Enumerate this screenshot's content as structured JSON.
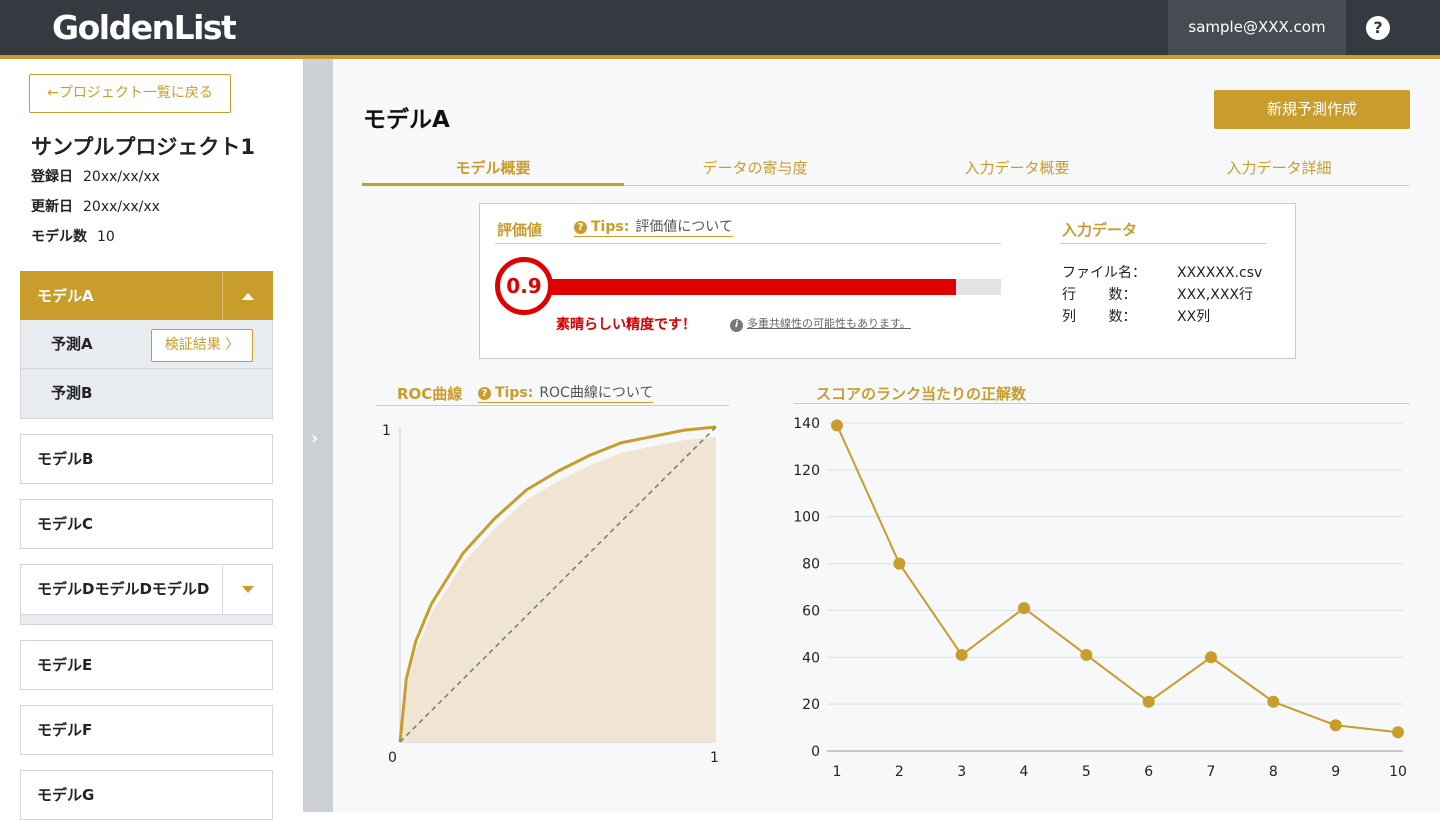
{
  "header": {
    "logo_text": "GoldenList",
    "user_email": "sample@XXX.com",
    "help_label": "?"
  },
  "sidebar": {
    "back_label": "←プロジェクト一覧に戻る",
    "project_title": "サンプルプロジェクト1",
    "meta": [
      {
        "label": "登録日",
        "value": "20xx/xx/xx"
      },
      {
        "label": "更新日",
        "value": "20xx/xx/xx"
      },
      {
        "label": "モデル数",
        "value": "10"
      }
    ],
    "models": [
      {
        "label": "モデルA",
        "active": true,
        "expanded": true,
        "predictions": [
          {
            "label": "予測A",
            "button": "検証結果 〉"
          },
          {
            "label": "予測B"
          }
        ]
      },
      {
        "label": "モデルB"
      },
      {
        "label": "モデルC"
      },
      {
        "label": "モデルDモデルDモデルD",
        "has_dropdown": true
      },
      {
        "label": "モデルE"
      },
      {
        "label": "モデルF"
      },
      {
        "label": "モデルG"
      }
    ],
    "divider_icon": "chevron-right-icon"
  },
  "main": {
    "title": "モデルA",
    "new_button": "新規予測作成",
    "tabs": [
      {
        "label": "モデル概要",
        "active": true
      },
      {
        "label": "データの寄与度"
      },
      {
        "label": "入力データ概要"
      },
      {
        "label": "入力データ詳細"
      }
    ],
    "evaluation": {
      "heading": "評価値",
      "tips_label": "Tips:",
      "tips_text": "評価値について",
      "score": "0.9",
      "score_fraction": 0.9,
      "message": "素晴らしい精度です！",
      "note": "多重共線性の可能性もあります。",
      "colors": {
        "bar": "#e00000",
        "track": "#e1e3e7"
      }
    },
    "input_data": {
      "heading": "入力データ",
      "rows": [
        {
          "key": "ファイル名：",
          "value": "XXXXXX.csv"
        },
        {
          "key": "行　　 数：",
          "value": "XXX,XXX行"
        },
        {
          "key": "列　　 数：",
          "value": "XX列"
        }
      ]
    },
    "roc": {
      "title": "ROC曲線",
      "tips_label": "Tips:",
      "tips_text": "ROC曲線について"
    },
    "rank": {
      "title": "スコアのランク当たりの正解数"
    }
  },
  "chart_data": [
    {
      "type": "area",
      "title": "ROC曲線",
      "xlim": [
        0,
        1
      ],
      "ylim": [
        0,
        1
      ],
      "x_ticks": [
        "0",
        "1"
      ],
      "y_ticks": [
        "1"
      ],
      "series": [
        {
          "values": [
            [
              0,
              0
            ],
            [
              0.02,
              0.2
            ],
            [
              0.05,
              0.32
            ],
            [
              0.1,
              0.44
            ],
            [
              0.2,
              0.6
            ],
            [
              0.3,
              0.71
            ],
            [
              0.4,
              0.8
            ],
            [
              0.5,
              0.86
            ],
            [
              0.6,
              0.91
            ],
            [
              0.7,
              0.95
            ],
            [
              0.8,
              0.97
            ],
            [
              0.9,
              0.99
            ],
            [
              1,
              1
            ]
          ]
        },
        {
          "style": "dashed",
          "values": [
            [
              0,
              0
            ],
            [
              1,
              1
            ]
          ]
        }
      ],
      "colors": {
        "curve": "#c99d2c",
        "fill": "#efe5d2",
        "diagonal": "#777777"
      }
    },
    {
      "type": "line",
      "title": "スコアのランク当たりの正解数",
      "categories": [
        "1",
        "2",
        "3",
        "4",
        "5",
        "6",
        "7",
        "8",
        "9",
        "10"
      ],
      "values": [
        139,
        80,
        41,
        61,
        41,
        21,
        40,
        21,
        11,
        8
      ],
      "ylim": [
        0,
        140
      ],
      "y_ticks": [
        "0",
        "20",
        "40",
        "60",
        "80",
        "100",
        "120",
        "140"
      ],
      "grid": true,
      "colors": {
        "line": "#c99d2c"
      }
    }
  ]
}
